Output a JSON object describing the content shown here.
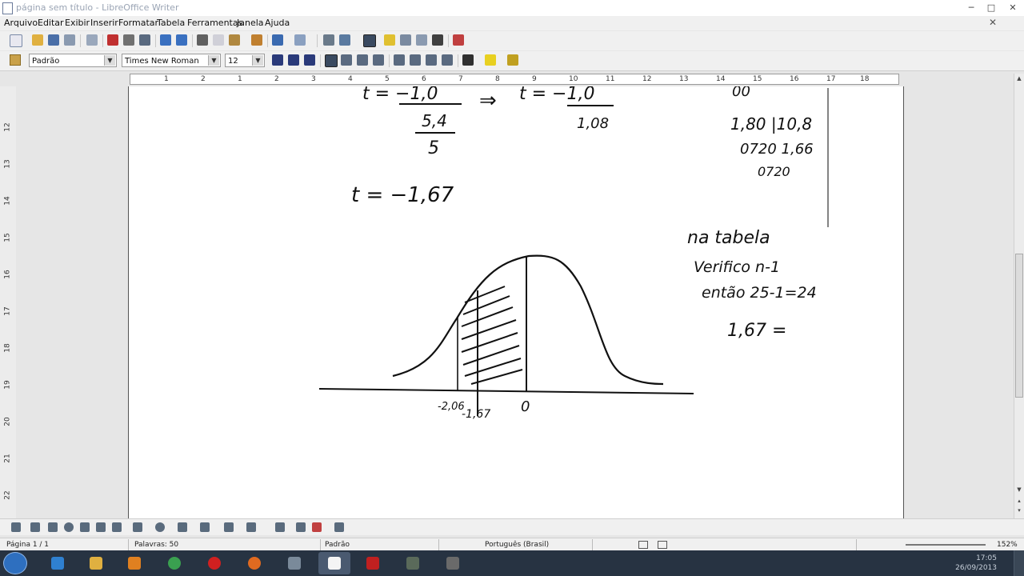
{
  "window": {
    "title": "página sem título - LibreOffice Writer",
    "minimize": "─",
    "maximize": "□",
    "close": "✕",
    "close_doc": "✕"
  },
  "menu": {
    "items": [
      "Arquivo",
      "Editar",
      "Exibir",
      "Inserir",
      "Formatar",
      "Tabela",
      "Ferramentas",
      "Janela",
      "Ajuda"
    ]
  },
  "formatting": {
    "style": "Padrão",
    "font": "Times New Roman",
    "size": "12"
  },
  "ruler": {
    "h_labels": [
      "1",
      "2",
      "1",
      "2",
      "3",
      "4",
      "5",
      "6",
      "7",
      "8",
      "9",
      "10",
      "11",
      "12",
      "13",
      "14",
      "15",
      "16",
      "17",
      "18"
    ],
    "v_labels": [
      "12",
      "13",
      "14",
      "15",
      "16",
      "17",
      "18",
      "19",
      "20",
      "21",
      "22"
    ]
  },
  "handwriting": {
    "t_fraction_left": "t = −1,0",
    "denominator_num": "5,4",
    "denominator_den": "5",
    "arrow": "⇒",
    "t_fraction_right": "t = −1,0",
    "right_den": "1,08",
    "top_right_fragment": "00",
    "division_line1": "1,80 |10,8",
    "division_line2": "0720  1,66",
    "division_line3": "0720",
    "t_result": "t = −1,67",
    "note_line1": "na tabela",
    "note_line2": "Verifico n-1",
    "note_line3": "então 25-1=24",
    "note_line4": "1,67 =",
    "axis_label_left": "-2,06",
    "axis_label_mid": "-1,67",
    "axis_label_zero": "0"
  },
  "status": {
    "page": "Página 1 / 1",
    "words": "Palavras: 50",
    "style": "Padrão",
    "language": "Português (Brasil)",
    "zoom": "152%"
  },
  "taskbar": {
    "time": "17:05",
    "date": "26/09/2013"
  },
  "colors": {
    "taskbar": "#273342",
    "chrome": "#f0f0f0",
    "page": "#ffffff",
    "ink": "#111111"
  }
}
